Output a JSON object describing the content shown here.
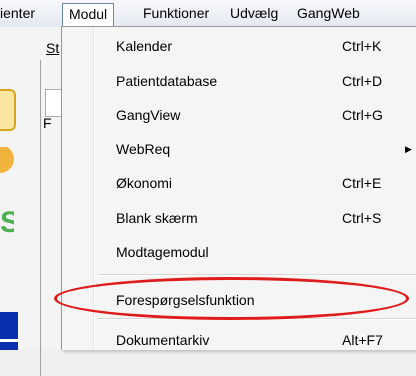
{
  "menubar": {
    "items": [
      {
        "label": "ienter"
      },
      {
        "label": "Modul"
      },
      {
        "label": "Funktioner"
      },
      {
        "label": "Udvælg"
      },
      {
        "label": "GangWeb"
      }
    ]
  },
  "background_panel": {
    "tab_fragment": "St",
    "group_fragment": "F"
  },
  "menu": {
    "items": [
      {
        "label": "Kalender",
        "shortcut": "Ctrl+K"
      },
      {
        "label": "Patientdatabase",
        "shortcut": "Ctrl+D"
      },
      {
        "label": "GangView",
        "shortcut": "Ctrl+G"
      },
      {
        "label": "WebReq",
        "shortcut": "",
        "submenu": true
      },
      {
        "label": "Økonomi",
        "shortcut": "Ctrl+E"
      },
      {
        "label": "Blank skærm",
        "shortcut": "Ctrl+S"
      },
      {
        "label": "Modtagemodul",
        "shortcut": ""
      },
      {
        "label": "Forespørgselsfunktion",
        "shortcut": ""
      },
      {
        "label": "Dokumentarkiv",
        "shortcut": "Alt+F7"
      }
    ],
    "submenu_arrow": "▶"
  },
  "annotation": {
    "color": "#e01b1b"
  }
}
